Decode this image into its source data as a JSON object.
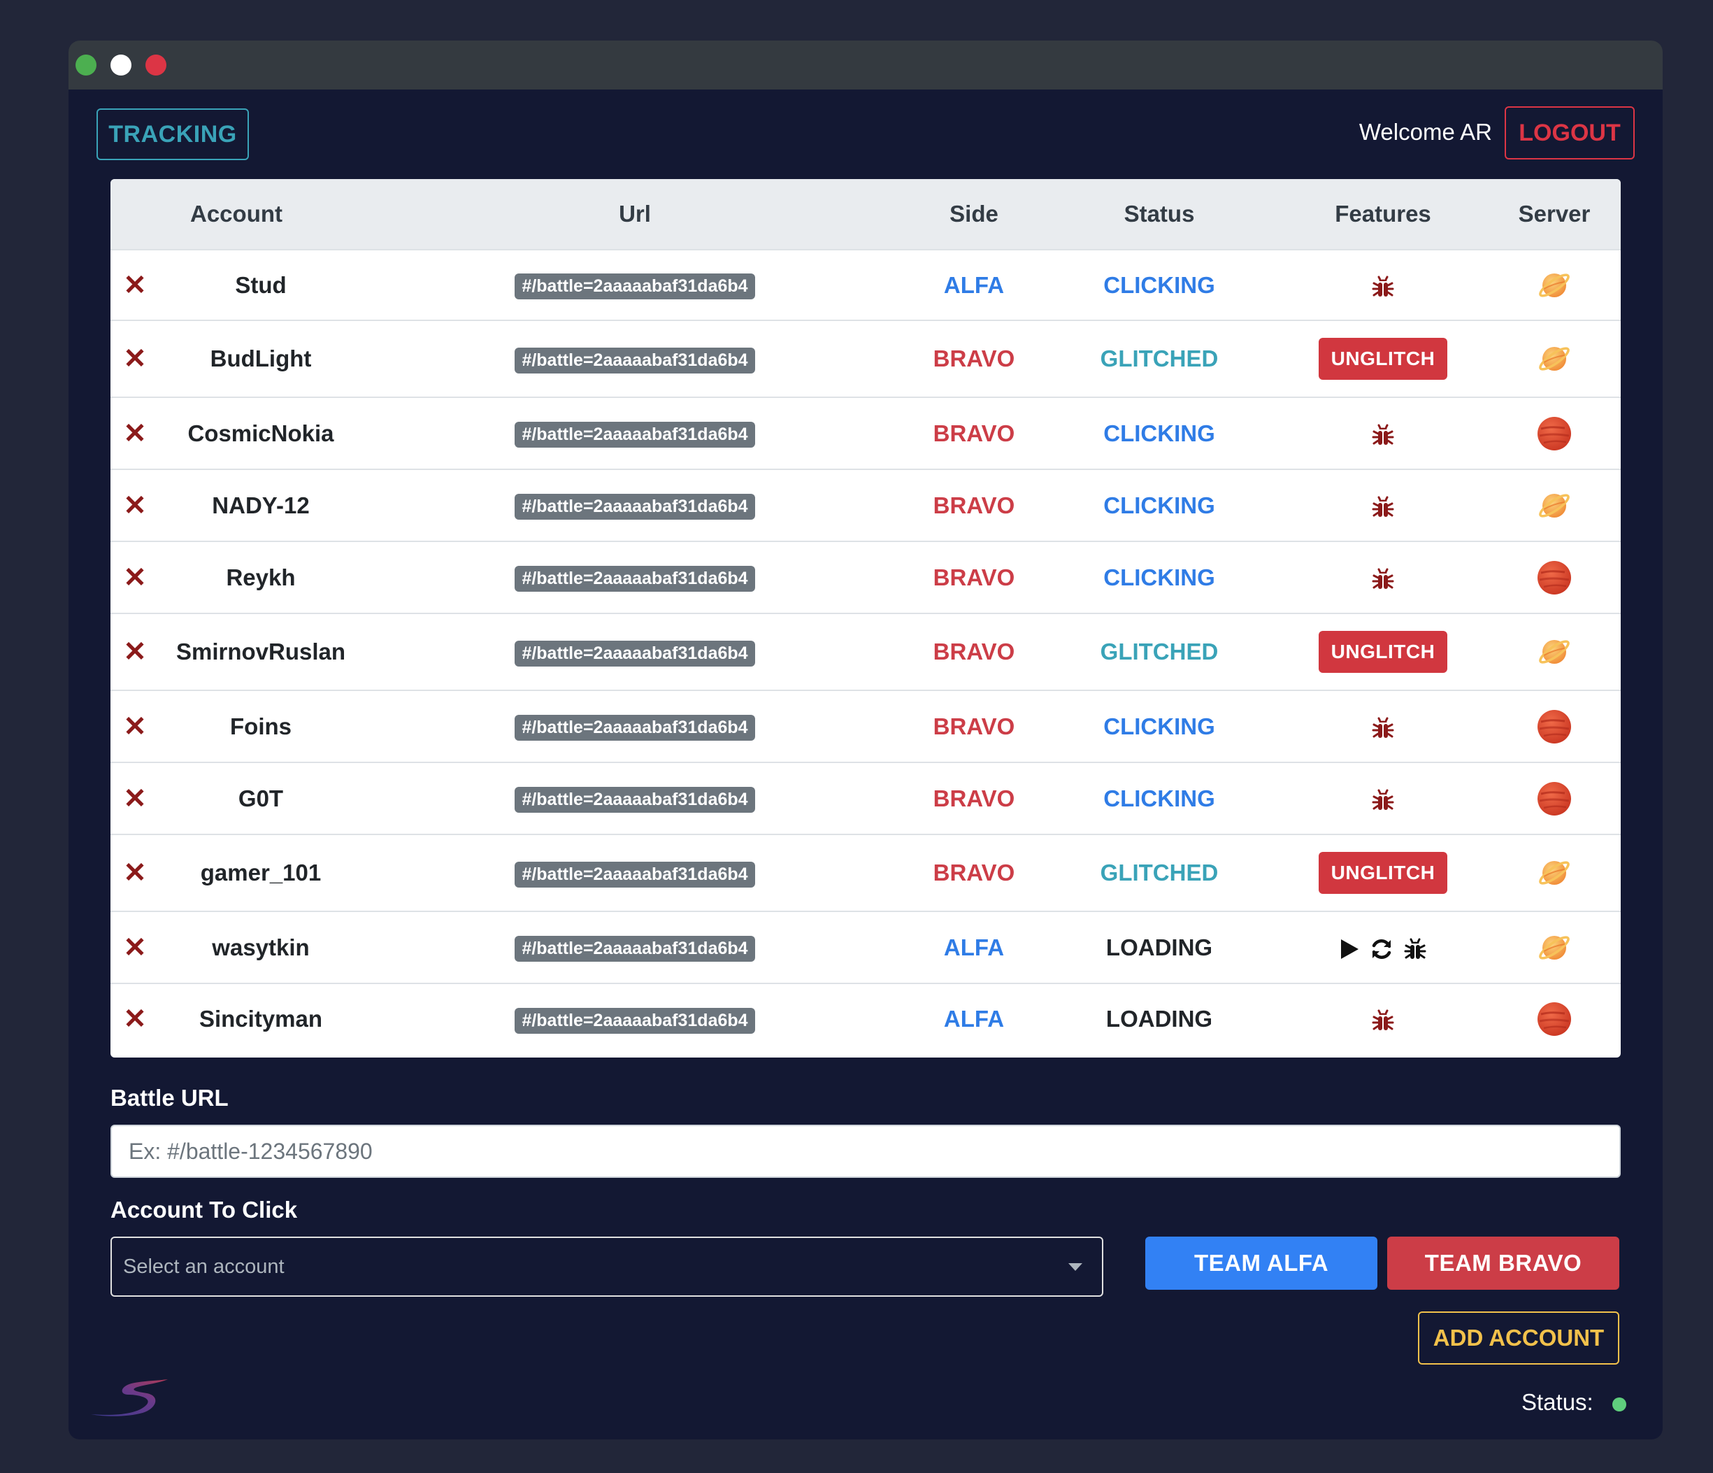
{
  "window": {
    "dots": [
      "green",
      "white",
      "red"
    ]
  },
  "header": {
    "tracking_label": "TRACKING",
    "welcome_text": "Welcome AR",
    "logout_label": "LOGOUT"
  },
  "table": {
    "columns": [
      "Account",
      "Url",
      "Side",
      "Status",
      "Features",
      "Server"
    ],
    "rows": [
      {
        "account": "Stud",
        "url": "#/battle=2aaaaabaf31da6b4",
        "side": "ALFA",
        "status": "CLICKING",
        "features": "bug",
        "server": "saturn"
      },
      {
        "account": "BudLight",
        "url": "#/battle=2aaaaabaf31da6b4",
        "side": "BRAVO",
        "status": "GLITCHED",
        "features": "unglitch",
        "server": "saturn"
      },
      {
        "account": "CosmicNokia",
        "url": "#/battle=2aaaaabaf31da6b4",
        "side": "BRAVO",
        "status": "CLICKING",
        "features": "bug",
        "server": "planet"
      },
      {
        "account": "NADY-12",
        "url": "#/battle=2aaaaabaf31da6b4",
        "side": "BRAVO",
        "status": "CLICKING",
        "features": "bug",
        "server": "saturn"
      },
      {
        "account": "Reykh",
        "url": "#/battle=2aaaaabaf31da6b4",
        "side": "BRAVO",
        "status": "CLICKING",
        "features": "bug",
        "server": "planet"
      },
      {
        "account": "SmirnovRuslan",
        "url": "#/battle=2aaaaabaf31da6b4",
        "side": "BRAVO",
        "status": "GLITCHED",
        "features": "unglitch",
        "server": "saturn"
      },
      {
        "account": "Foins",
        "url": "#/battle=2aaaaabaf31da6b4",
        "side": "BRAVO",
        "status": "CLICKING",
        "features": "bug",
        "server": "planet"
      },
      {
        "account": "G0T",
        "url": "#/battle=2aaaaabaf31da6b4",
        "side": "BRAVO",
        "status": "CLICKING",
        "features": "bug",
        "server": "planet"
      },
      {
        "account": "gamer_101",
        "url": "#/battle=2aaaaabaf31da6b4",
        "side": "BRAVO",
        "status": "GLITCHED",
        "features": "unglitch",
        "server": "saturn"
      },
      {
        "account": "wasytkin",
        "url": "#/battle=2aaaaabaf31da6b4",
        "side": "ALFA",
        "status": "LOADING",
        "features": "play-refresh-bug",
        "server": "saturn"
      },
      {
        "account": "Sincityman",
        "url": "#/battle=2aaaaabaf31da6b4",
        "side": "ALFA",
        "status": "LOADING",
        "features": "bug",
        "server": "planet"
      }
    ],
    "unglitch_label": "UNGLITCH",
    "delete_glyph": "✕"
  },
  "form": {
    "battle_url_label": "Battle URL",
    "battle_url_placeholder": "Ex: #/battle-1234567890",
    "account_label": "Account To Click",
    "account_select_value": "Select an account",
    "team_alfa_label": "TEAM ALFA",
    "team_bravo_label": "TEAM BRAVO",
    "add_account_label": "ADD ACCOUNT"
  },
  "footer": {
    "status_label": "Status:",
    "status_color": "#5fce7d"
  },
  "colors": {
    "alfa": "#2f7ce6",
    "bravo": "#cc3d47",
    "glitched": "#3aa3b8",
    "bug": "#8b1a1a"
  }
}
